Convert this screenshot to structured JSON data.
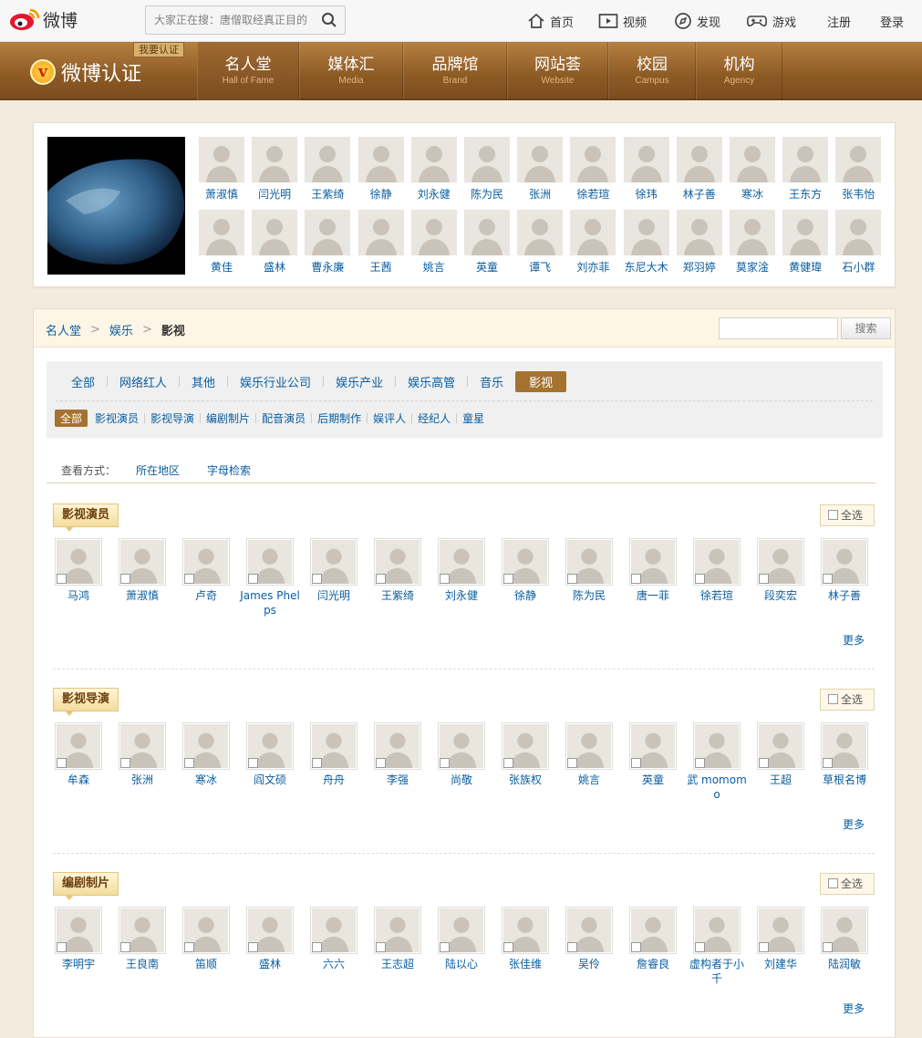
{
  "topbar": {
    "logo_text": "微博",
    "search_placeholder": "大家正在搜：唐僧取经真正目的",
    "nav": [
      {
        "label": "首页",
        "icon": "home-icon"
      },
      {
        "label": "视频",
        "icon": "video-icon"
      },
      {
        "label": "发现",
        "icon": "compass-icon"
      },
      {
        "label": "游戏",
        "icon": "gamepad-icon"
      },
      {
        "label": "注册",
        "icon": ""
      },
      {
        "label": "登录",
        "icon": ""
      }
    ]
  },
  "band": {
    "brand_text": "微博认证",
    "brand_icon": "v",
    "apply_label": "我要认证",
    "tabs": [
      {
        "zh": "名人堂",
        "en": "Hall of Fame",
        "active": true
      },
      {
        "zh": "媒体汇",
        "en": "Media",
        "active": false
      },
      {
        "zh": "品牌馆",
        "en": "Brand",
        "active": false
      },
      {
        "zh": "网站荟",
        "en": "Website",
        "active": false
      },
      {
        "zh": "校园",
        "en": "Campus",
        "active": false
      },
      {
        "zh": "机构",
        "en": "Agency",
        "active": false
      }
    ]
  },
  "featured": {
    "row1": [
      "萧淑慎",
      "闫光明",
      "王紫绮",
      "徐静",
      "刘永健",
      "陈为民",
      "张洲",
      "徐若瑄",
      "徐玮",
      "林子善",
      "寒冰",
      "王东方",
      "张韦怡"
    ],
    "row2": [
      "黄佳",
      "盛林",
      "曹永廉",
      "王茜",
      "姚言",
      "英童",
      "谭飞",
      "刘亦菲",
      "东尼大木",
      "郑羽婷",
      "莫家淦",
      "黄健瑋",
      "石小群"
    ]
  },
  "crumb": {
    "items": [
      "名人堂",
      "娱乐"
    ],
    "current": "影视",
    "search_button": "搜索",
    "search_value": ""
  },
  "filter": {
    "primary": [
      {
        "label": "全部",
        "active": false
      },
      {
        "label": "网络红人",
        "active": false
      },
      {
        "label": "其他",
        "active": false
      },
      {
        "label": "娱乐行业公司",
        "active": false
      },
      {
        "label": "娱乐产业",
        "active": false
      },
      {
        "label": "娱乐高管",
        "active": false
      },
      {
        "label": "音乐",
        "active": false
      },
      {
        "label": "影视",
        "active": true
      }
    ],
    "secondary": [
      {
        "label": "全部",
        "active": true
      },
      {
        "label": "影视演员",
        "active": false
      },
      {
        "label": "影视导演",
        "active": false
      },
      {
        "label": "编剧制片",
        "active": false
      },
      {
        "label": "配音演员",
        "active": false
      },
      {
        "label": "后期制作",
        "active": false
      },
      {
        "label": "娱评人",
        "active": false
      },
      {
        "label": "经纪人",
        "active": false
      },
      {
        "label": "童星",
        "active": false
      }
    ]
  },
  "viewby": {
    "label": "查看方式：",
    "options": [
      "所在地区",
      "字母检索"
    ]
  },
  "sections": [
    {
      "title": "影视演员",
      "select_all": "全选",
      "more": "更多",
      "people": [
        "马鸿",
        "萧淑慎",
        "卢奇",
        "James Phelps",
        "闫光明",
        "王紫绮",
        "刘永健",
        "徐静",
        "陈为民",
        "唐一菲",
        "徐若瑄",
        "段奕宏",
        "林子善"
      ]
    },
    {
      "title": "影视导演",
      "select_all": "全选",
      "more": "更多",
      "people": [
        "牟森",
        "张洲",
        "寒冰",
        "阎文硕",
        "舟舟",
        "李强",
        "尚敬",
        "张族权",
        "姚言",
        "英童",
        "武 momomo",
        "王超",
        "草根名博"
      ]
    },
    {
      "title": "编剧制片",
      "select_all": "全选",
      "more": "更多",
      "people": [
        "李明宇",
        "王良南",
        "笛顺",
        "盛林",
        "六六",
        "王志超",
        "陆以心",
        "张佳维",
        "吴伶",
        "詹睿良",
        "虚构者于小千",
        "刘建华",
        "陆润敏"
      ]
    }
  ],
  "colors": {
    "accent_brown": "#a57330",
    "link_blue": "#0a5ea1",
    "band_dark": "#7c4d1e"
  }
}
